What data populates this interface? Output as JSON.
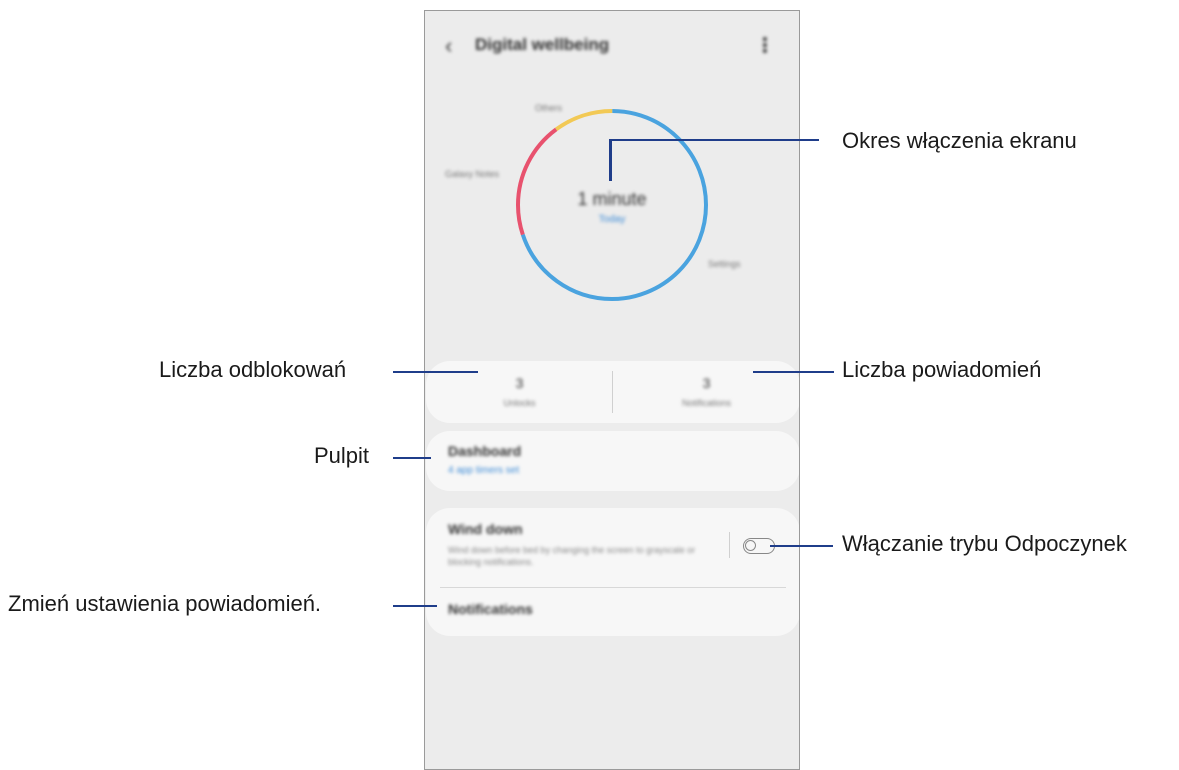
{
  "phone": {
    "app_bar": {
      "title": "Digital wellbeing"
    },
    "chart": {
      "labels": [
        "Others",
        "Galaxy Notes",
        "Settings"
      ],
      "center_value": "1 minute",
      "center_sub": "Today",
      "colors": {
        "settings": "#4aa3df",
        "others": "#f2c955",
        "galaxy_notes": "#e8526e"
      }
    },
    "stats": {
      "unlocks": {
        "value": "3",
        "label": "Unlocks"
      },
      "notifications": {
        "value": "3",
        "label": "Notifications"
      }
    },
    "dashboard": {
      "title": "Dashboard",
      "subtitle": "4 app timers set"
    },
    "wind_down": {
      "title": "Wind down",
      "description": "Wind down before bed by changing the screen to grayscale or blocking notifications.",
      "toggle_on": false
    },
    "notifications_row": {
      "title": "Notifications"
    }
  },
  "callouts": {
    "screen_time": "Okres włączenia ekranu",
    "unlocks": "Liczba odblokowań",
    "notifications": "Liczba powiadomień",
    "dashboard": "Pulpit",
    "wind_down": "Włączanie trybu Odpoczynek",
    "notification_settings": "Zmień ustawienia powiadomień."
  },
  "colors": {
    "leader": "#1f3d8a"
  }
}
